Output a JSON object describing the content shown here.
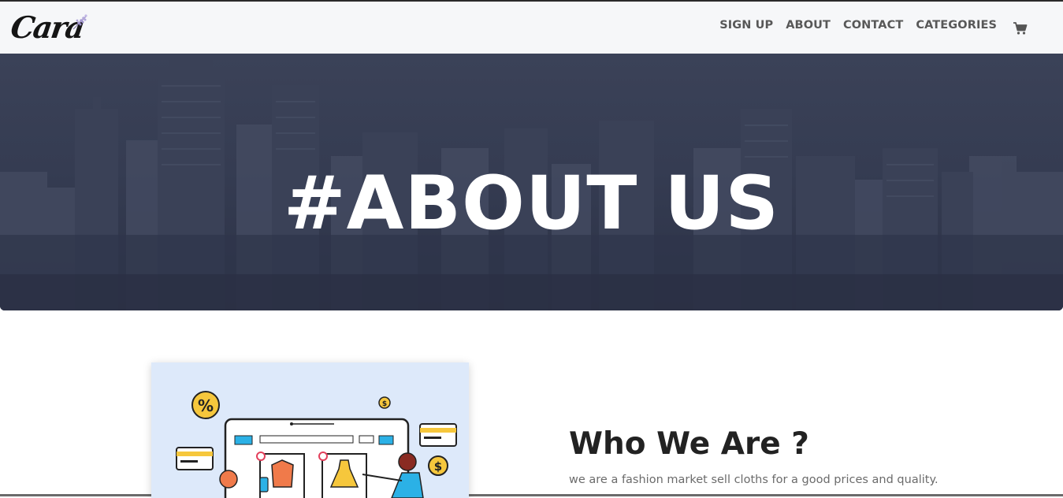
{
  "brand": {
    "logo_text": "Cara"
  },
  "nav": {
    "items": [
      {
        "label": "SIGN UP"
      },
      {
        "label": "ABOUT"
      },
      {
        "label": "CONTACT"
      },
      {
        "label": "CATEGORIES"
      }
    ],
    "cart_icon": "shopping-cart-icon"
  },
  "hero": {
    "title": "#ABOUT US"
  },
  "about": {
    "heading": "Who We Are ?",
    "paragraph": "we are a fashion market sell cloths for a good prices and quality."
  },
  "colors": {
    "navbar_bg": "#f6f7f9",
    "hero_overlay": "#353c52",
    "heading": "#222222",
    "body_text": "#6b6b6b"
  }
}
